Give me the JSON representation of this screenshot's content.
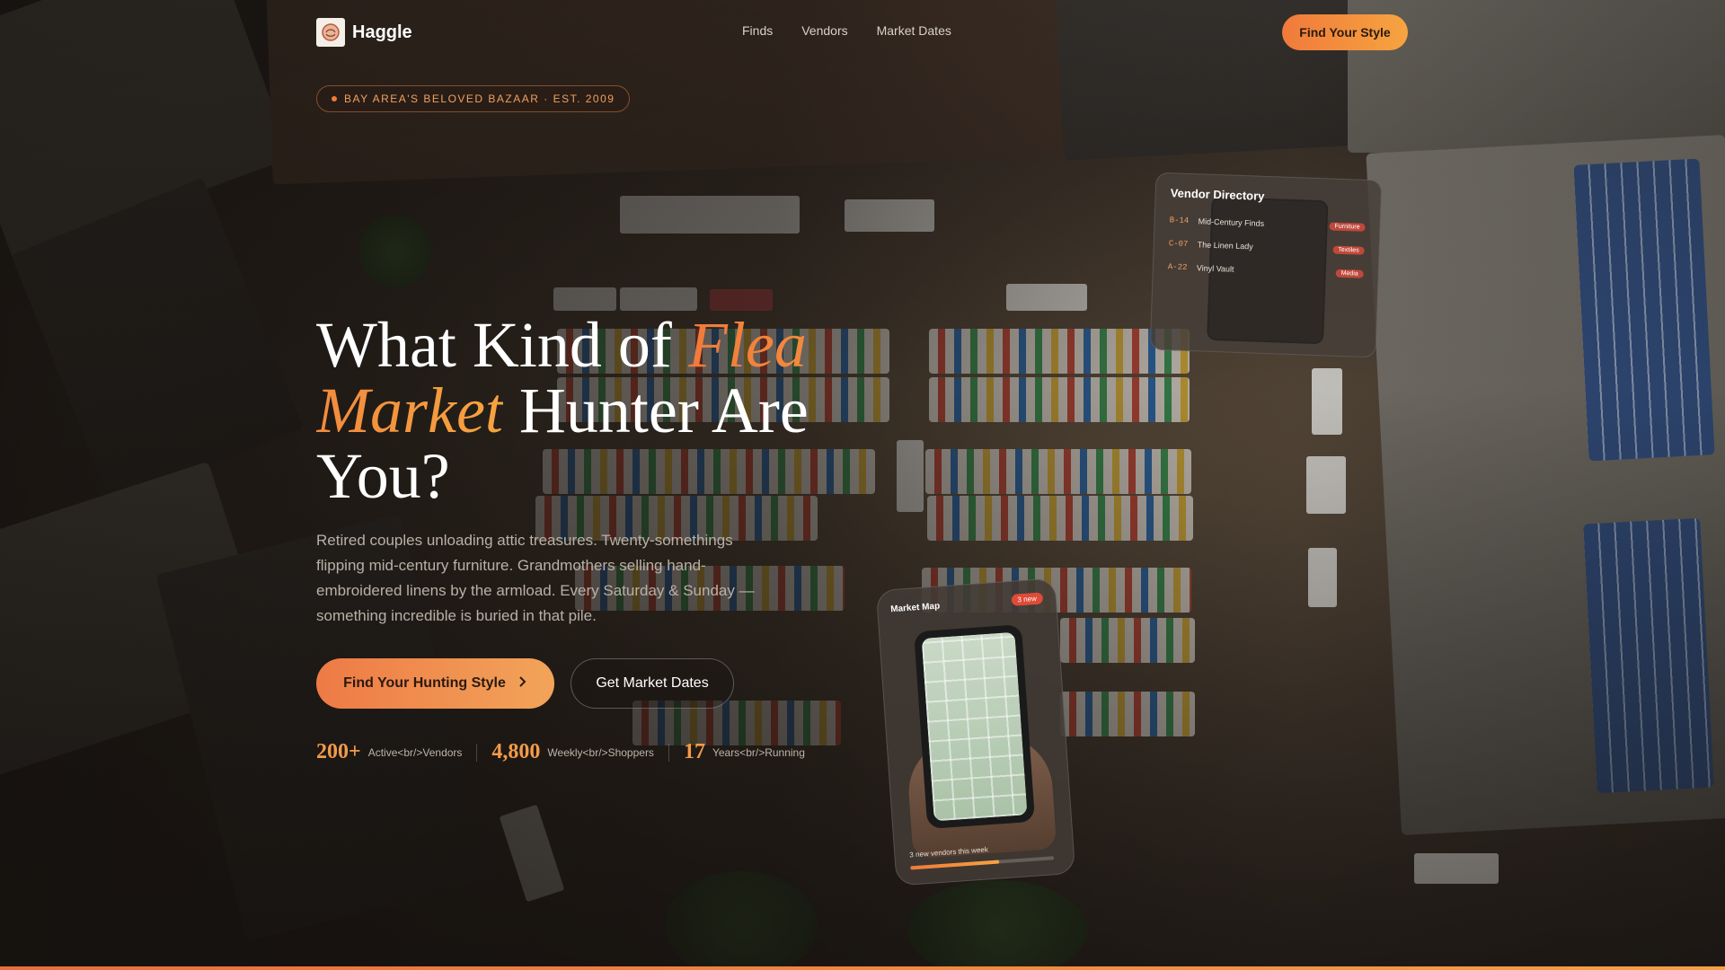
{
  "brand": {
    "name": "Haggle"
  },
  "nav": {
    "links": [
      "Finds",
      "Vendors",
      "Market Dates"
    ],
    "cta": "Find Your Style"
  },
  "hero": {
    "badge": "BAY AREA'S BELOVED BAZAAR · EST. 2009",
    "headline": {
      "part1": "What Kind of ",
      "accent": "Flea Market",
      "part2": " Hunter Are You?"
    },
    "lede": "Retired couples unloading attic treasures. Twenty-somethings flipping mid-century furniture. Grandmothers selling hand-embroidered linens by the armload. Every Saturday & Sunday — something incredible is buried in that pile.",
    "primary_cta": "Find Your Hunting Style",
    "secondary_cta": "Get Market Dates",
    "stats": [
      {
        "value": "200+",
        "label": "Active<br/>Vendors"
      },
      {
        "value": "4,800",
        "label": "Weekly<br/>Shoppers"
      },
      {
        "value": "17",
        "label": "Years<br/>Running"
      }
    ]
  },
  "vendor_directory": {
    "title": "Vendor Directory",
    "rows": [
      {
        "code": "B-14",
        "name": "Mid-Century Finds",
        "tag": "Furniture"
      },
      {
        "code": "C-07",
        "name": "The Linen Lady",
        "tag": "Textiles"
      },
      {
        "code": "A-22",
        "name": "Vinyl Vault",
        "tag": "Media"
      }
    ]
  },
  "market_map": {
    "title": "Market Map",
    "pill": "3 new",
    "footer": "3 new vendors this week",
    "progress": 0.62
  },
  "colors": {
    "accent": "#f07a3b",
    "accent2": "#f6a440"
  },
  "icons": {
    "chevron": "chevron-right-icon",
    "logo": "haggle-logo-icon"
  }
}
